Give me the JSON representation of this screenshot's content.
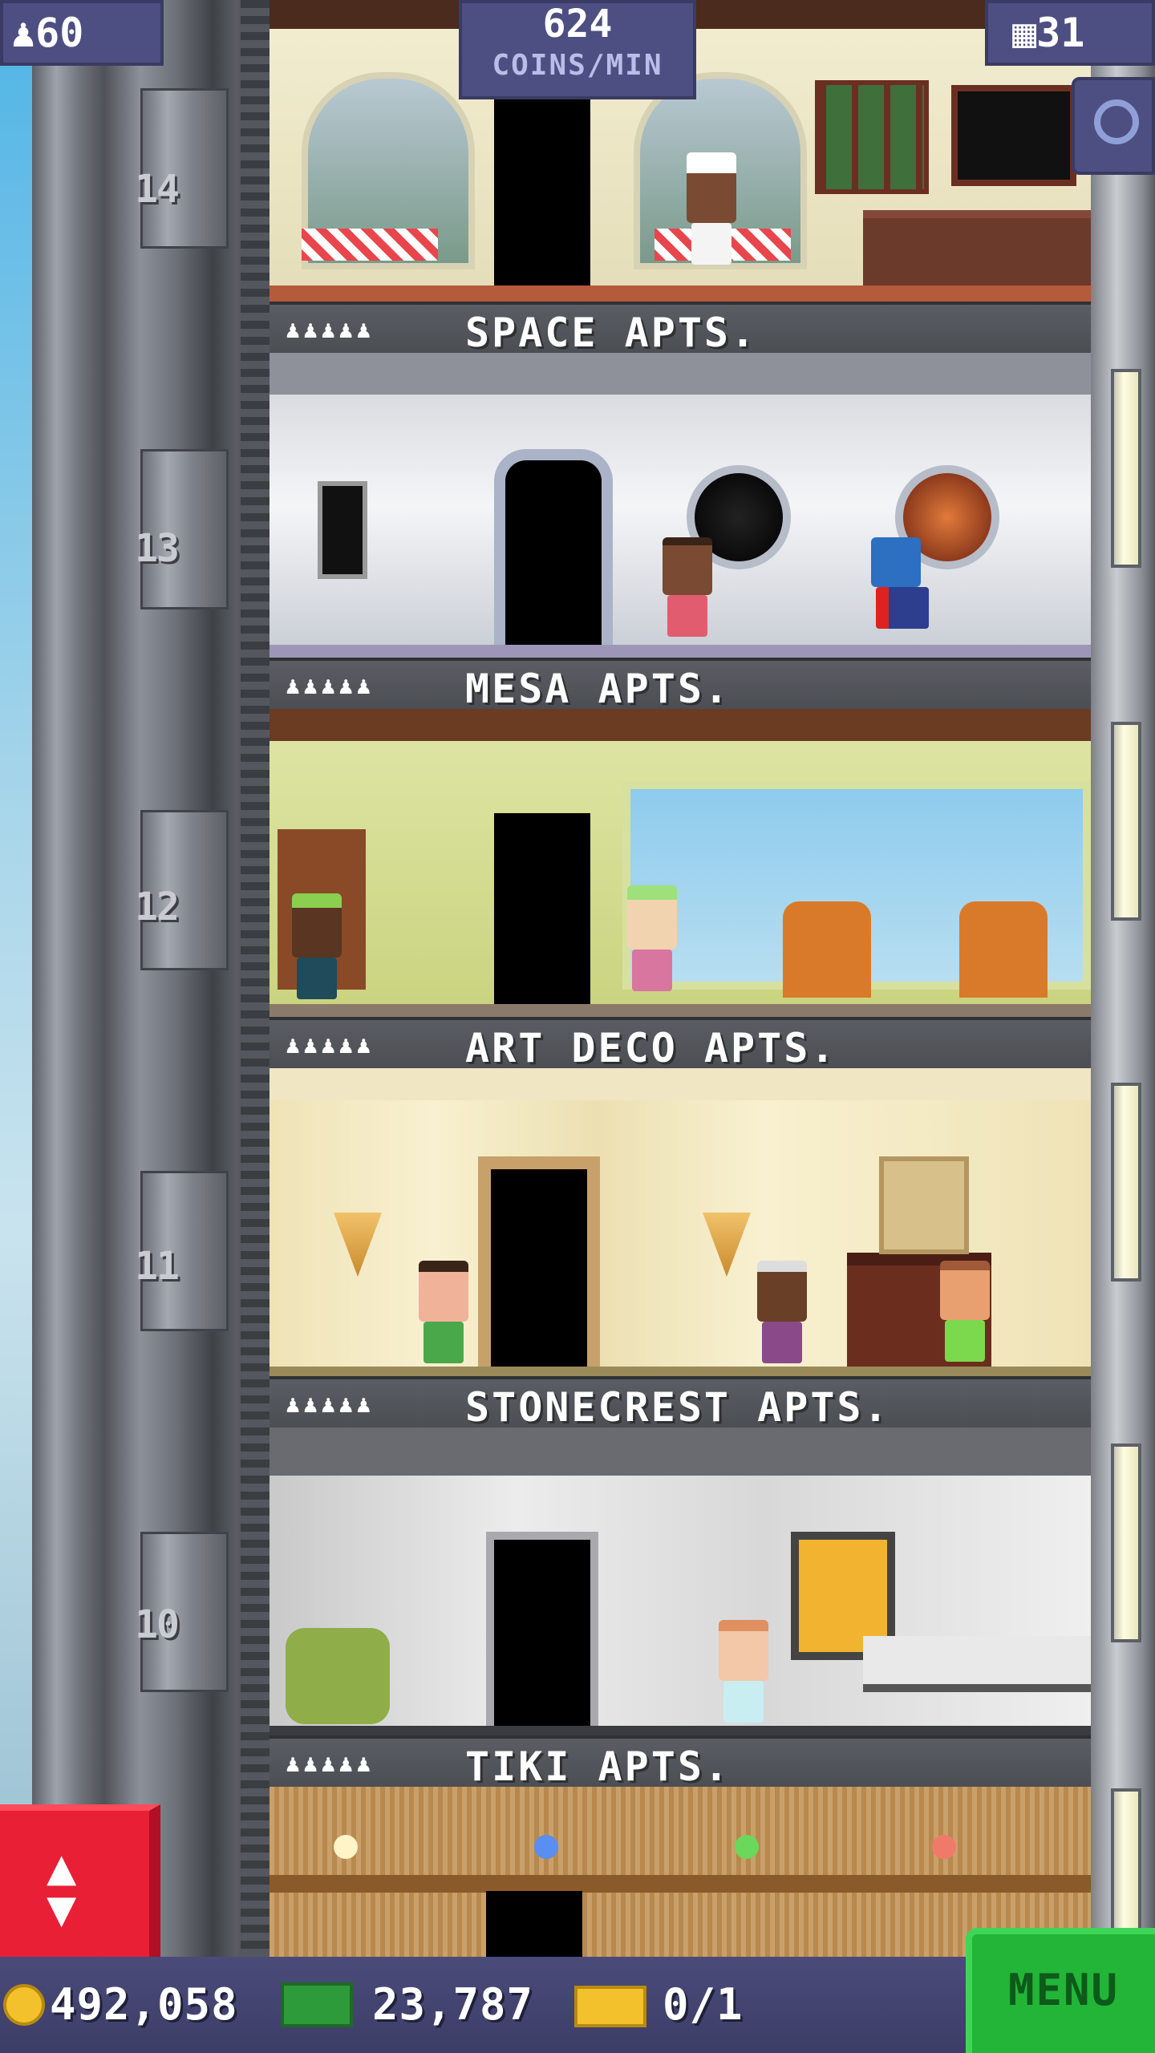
{
  "hud": {
    "population": "60",
    "coins_rate_value": "624",
    "coins_rate_unit": "COINS/MIN",
    "floors": "31"
  },
  "floors": [
    {
      "number": "14",
      "name": "SPACE APTS."
    },
    {
      "number": "13",
      "name": "MESA APTS."
    },
    {
      "number": "12",
      "name": "ART DECO APTS."
    },
    {
      "number": "11",
      "name": "STONECREST APTS."
    },
    {
      "number": "10",
      "name": "TIKI APTS."
    }
  ],
  "resident_slots": "♟♟♟♟♟",
  "bottom_bar": {
    "coins": "492,058",
    "bux": "23,787",
    "tickets": "0/1",
    "menu_label": "MENU"
  },
  "icons": {
    "population": "person-icon",
    "floors": "building-icon",
    "search": "magnifier-icon",
    "elevator": "elevator-arrows-icon",
    "coins": "coin-icon",
    "bux": "bux-icon",
    "tickets": "ticket-icon"
  },
  "colors": {
    "hud_bg": "#4d4f82",
    "menu_green": "#22b538",
    "elevator_red": "#e81f35",
    "coin_gold": "#f3c12b",
    "bux_green": "#2e9b3a"
  }
}
